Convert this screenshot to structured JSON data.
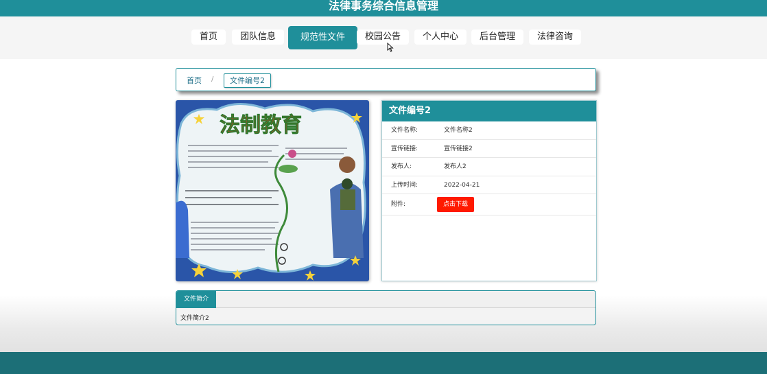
{
  "header": {
    "title": "法律事务综合信息管理"
  },
  "nav": {
    "items": [
      "首页",
      "团队信息",
      "规范性文件",
      "校园公告",
      "个人中心",
      "后台管理",
      "法律咨询"
    ],
    "active_index": 2
  },
  "breadcrumb": {
    "home": "首页",
    "separator": "/",
    "current": "文件编号2"
  },
  "poster": {
    "title_text": "法制教育"
  },
  "detail": {
    "title": "文件编号2",
    "rows": [
      {
        "label": "文件名称:",
        "value": "文件名称2"
      },
      {
        "label": "宣传链接:",
        "value": "宣传链接2"
      },
      {
        "label": "发布人:",
        "value": "发布人2"
      },
      {
        "label": "上传时间:",
        "value": "2022-04-21"
      }
    ],
    "attachment_label": "附件:",
    "download_label": "点击下载"
  },
  "description": {
    "tab_label": "文件简介",
    "content": "文件简介2"
  },
  "colors": {
    "primary": "#1f8f9a",
    "footer": "#1c6f77",
    "download": "#ff1a00"
  }
}
